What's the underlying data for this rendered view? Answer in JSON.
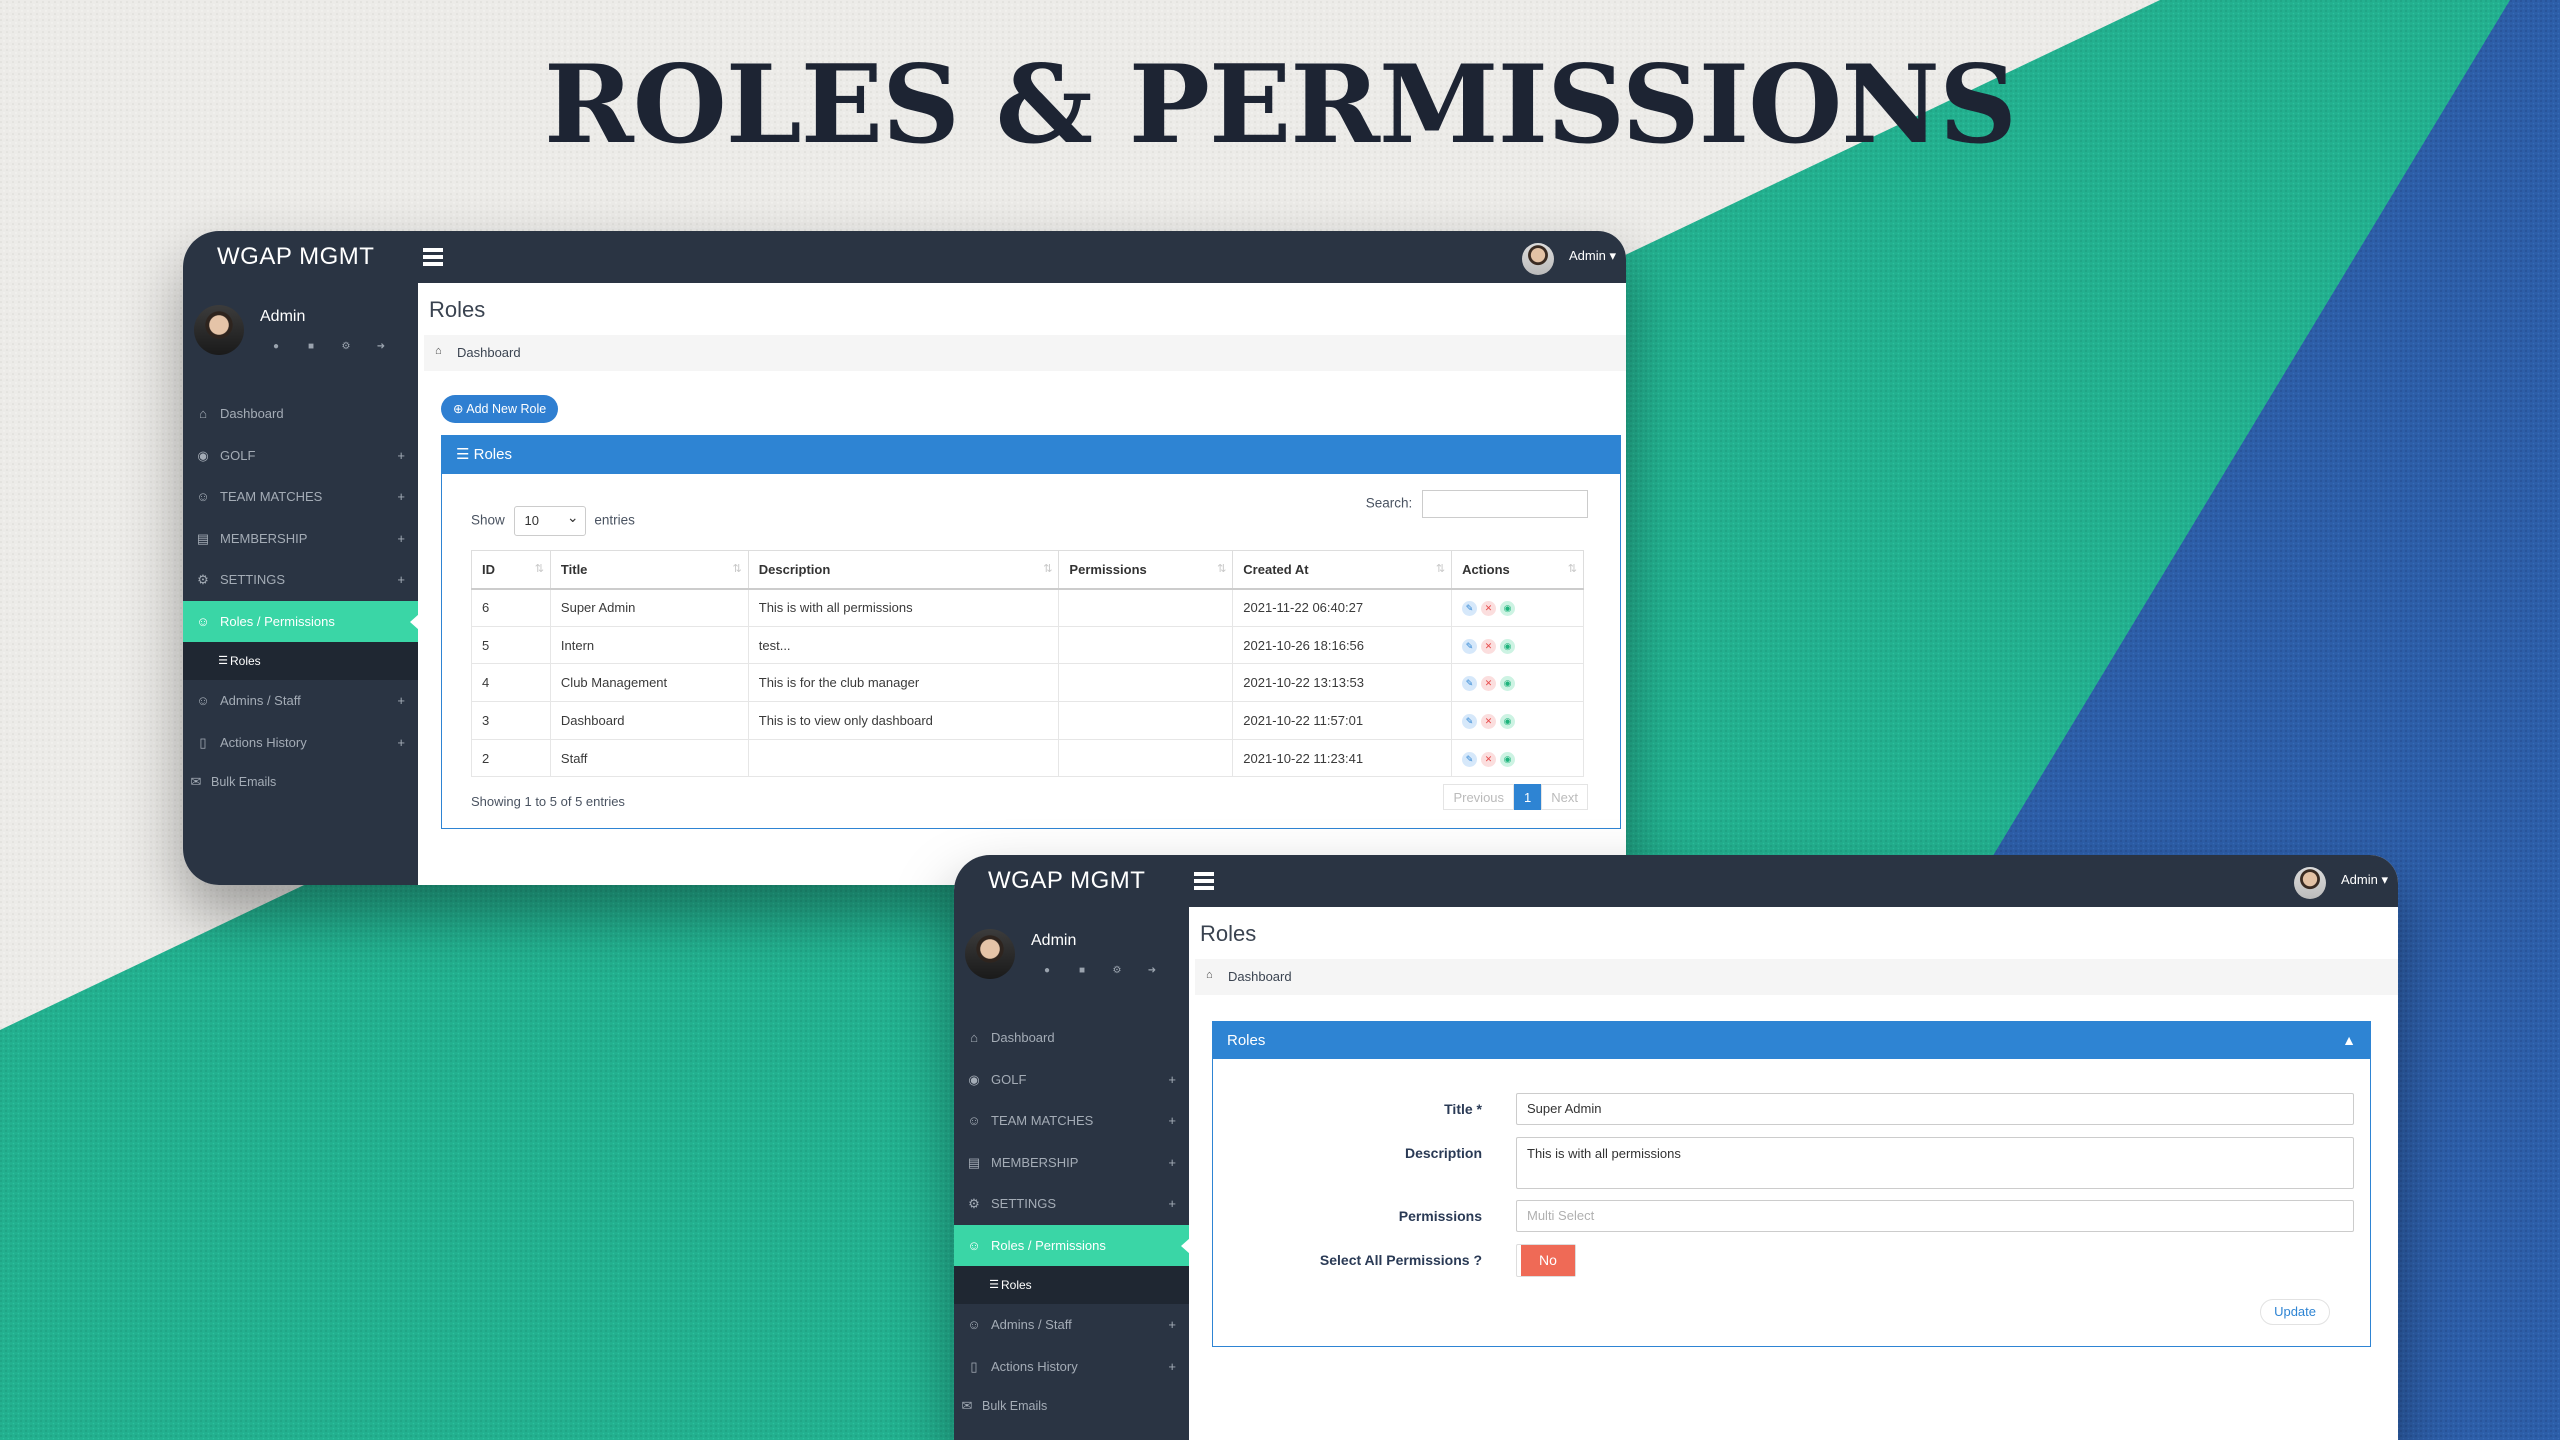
{
  "headline": "ROLES & PERMISSIONS",
  "colors": {
    "accent_teal": "#3ad6a6",
    "primary_blue": "#2e84d3",
    "dark_navy": "#2a3443",
    "danger": "#ef6a56"
  },
  "app": {
    "brand": "WGAP MGMT",
    "topbar_user": "Admin",
    "sidebar_user": "Admin",
    "profile_icons": [
      "user-icon",
      "lock-icon",
      "gear-icon",
      "logout-icon"
    ],
    "menu": [
      {
        "label": "Dashboard",
        "icon": "home-icon"
      },
      {
        "label": "GOLF",
        "icon": "map-pin-icon",
        "plus": "+"
      },
      {
        "label": "TEAM MATCHES",
        "icon": "user-icon",
        "plus": "+"
      },
      {
        "label": "MEMBERSHIP",
        "icon": "list-icon",
        "plus": "+"
      },
      {
        "label": "SETTINGS",
        "icon": "gear-icon",
        "plus": "+"
      },
      {
        "label": "Roles / Permissions",
        "icon": "user-icon"
      },
      {
        "label": "Roles",
        "icon": "list-icon"
      },
      {
        "label": "Admins / Staff",
        "icon": "user-icon",
        "plus": "+"
      },
      {
        "label": "Actions History",
        "icon": "book-icon",
        "plus": "+"
      },
      {
        "label": "Bulk Emails",
        "icon": "envelope-icon"
      }
    ],
    "page_title": "Roles",
    "breadcrumb": "Dashboard"
  },
  "list_screen": {
    "add_button": "Add New Role",
    "panel_title": "Roles",
    "show_label": "Show",
    "entries_value": "10",
    "entries_label": "entries",
    "search_label": "Search:",
    "columns": [
      "ID",
      "Title",
      "Description",
      "Permissions",
      "Created At",
      "Actions"
    ],
    "rows": [
      {
        "id": "6",
        "title": "Super Admin",
        "description": "This is with all permissions",
        "permissions": "",
        "created": "2021-11-22 06:40:27"
      },
      {
        "id": "5",
        "title": "Intern",
        "description": "test...",
        "permissions": "",
        "created": "2021-10-26 18:16:56"
      },
      {
        "id": "4",
        "title": "Club Management",
        "description": "This is for the club manager",
        "permissions": "",
        "created": "2021-10-22 13:13:53"
      },
      {
        "id": "3",
        "title": "Dashboard",
        "description": "This is to view only dashboard",
        "permissions": "",
        "created": "2021-10-22 11:57:01"
      },
      {
        "id": "2",
        "title": "Staff",
        "description": "",
        "permissions": "",
        "created": "2021-10-22 11:23:41"
      }
    ],
    "info": "Showing 1 to 5 of 5 entries",
    "pager": {
      "previous": "Previous",
      "current": "1",
      "next": "Next"
    }
  },
  "edit_screen": {
    "panel_title": "Roles",
    "title_label": "Title *",
    "title_value": "Super Admin",
    "description_label": "Description",
    "description_value": "This is with all permissions",
    "permissions_label": "Permissions",
    "permissions_placeholder": "Multi Select",
    "select_all_label": "Select All Permissions ?",
    "toggle_value": "No",
    "update_button": "Update"
  }
}
